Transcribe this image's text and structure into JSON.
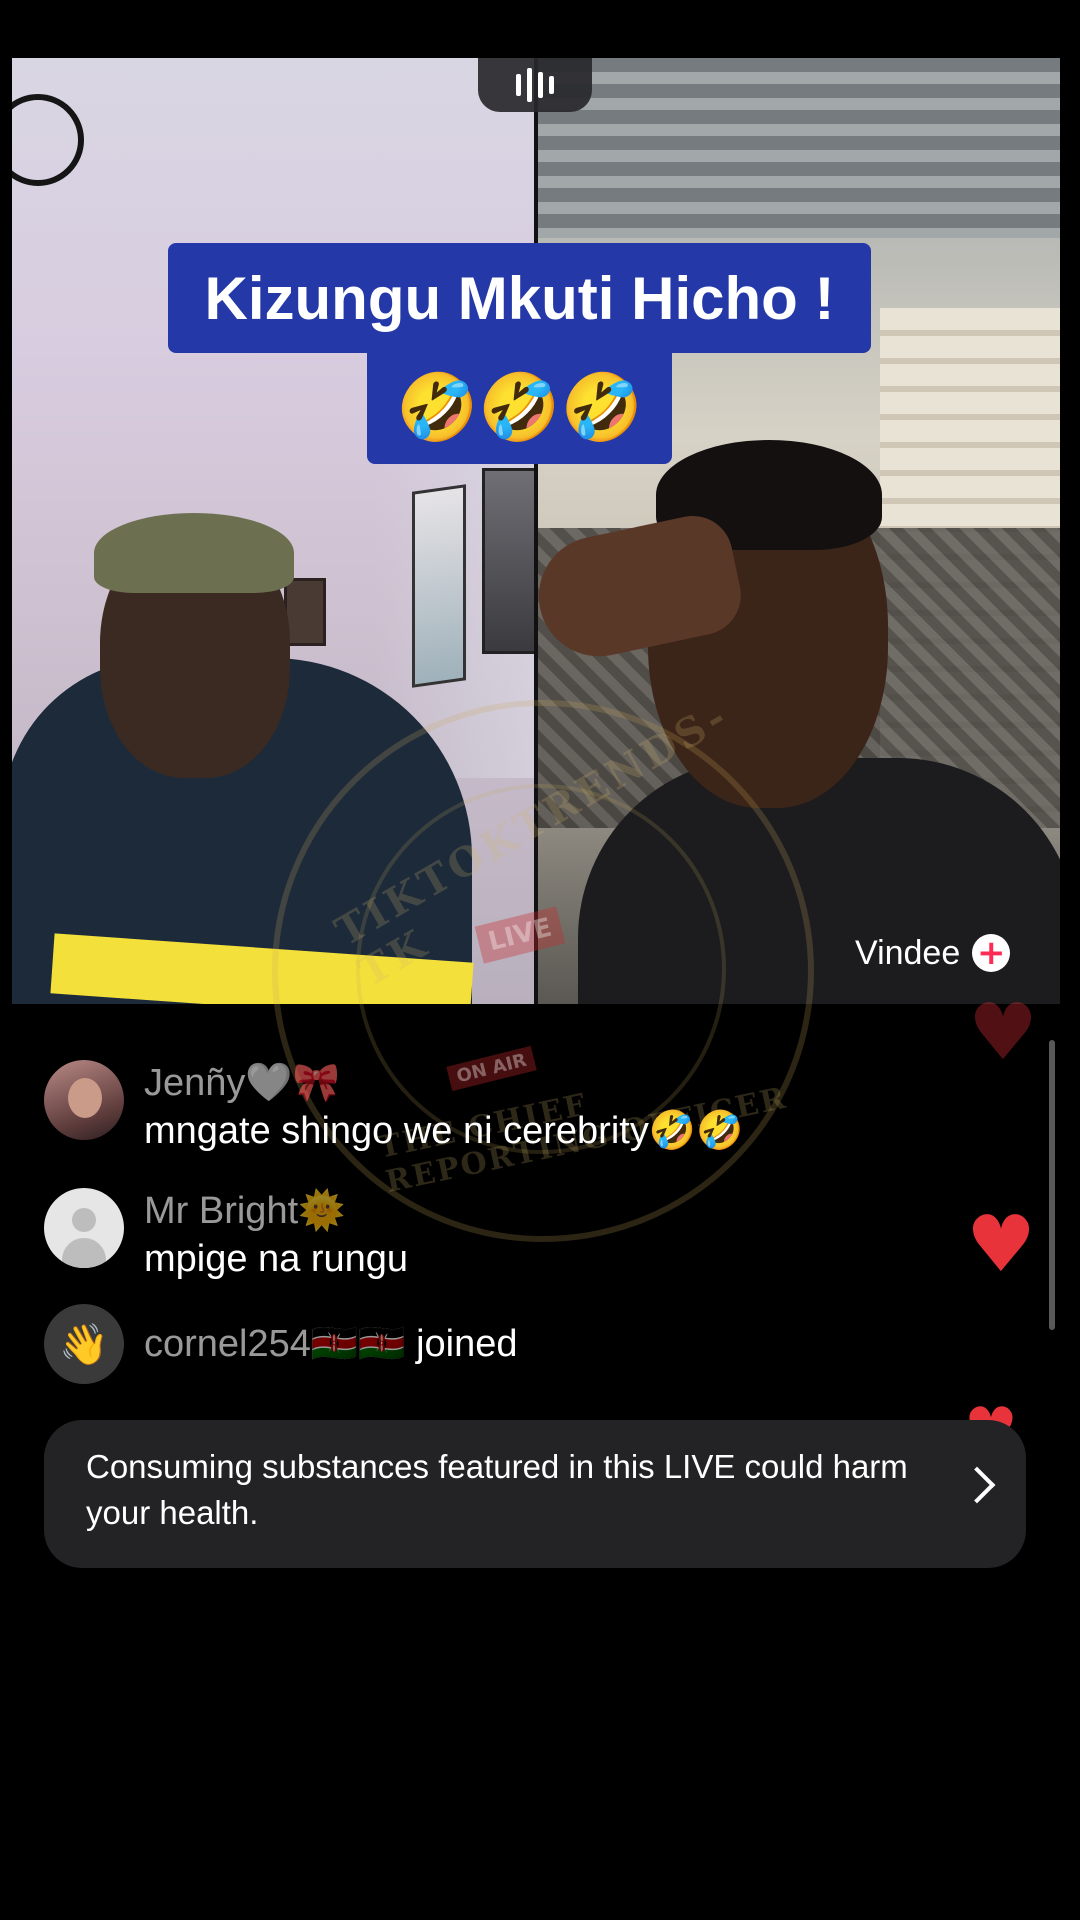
{
  "overlay": {
    "caption_line1": "Kizungu Mkuti Hicho !",
    "caption_line2": "🤣🤣🤣"
  },
  "guest": {
    "name": "Vindee",
    "follow_icon": "plus-icon"
  },
  "comments": [
    {
      "user": "Jenñy🤍🎀",
      "text": "mngate shingo we ni cerebrity🤣🤣",
      "avatar": "photo"
    },
    {
      "user": "Mr Bright🌞",
      "text": "mpige na rungu",
      "avatar": "default-avatar-icon"
    }
  ],
  "join_event": {
    "user": "cornel254🇰🇪🇰🇪",
    "action": "joined",
    "icon": "waving-hand-icon"
  },
  "notice": {
    "text": "Consuming substances featured in this LIVE could harm your health.",
    "icon": "chevron-right-icon"
  },
  "hearts": {
    "color": "#e8333b",
    "icon": "heart-icon"
  },
  "watermark": {
    "top_text": "TIKTOKTRENDS-TK",
    "bottom_text": "THE CHIEF REPORTING OFFICER",
    "badge_live": "LIVE",
    "badge_onair": "ON AIR"
  },
  "colors": {
    "caption_bg": "#2438a8",
    "notice_bg": "#232325",
    "accent": "#fe2c55"
  }
}
